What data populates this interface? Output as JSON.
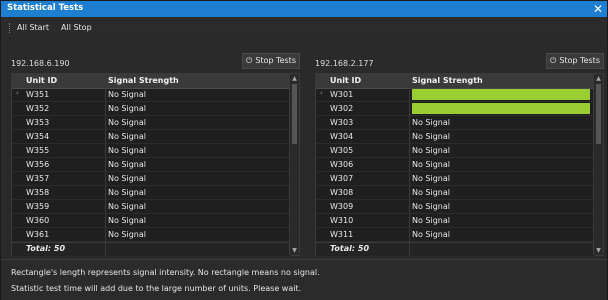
{
  "window": {
    "title": "Statistical Tests",
    "close_icon": "close-icon"
  },
  "menubar": {
    "items": [
      "All Start",
      "All Stop"
    ]
  },
  "colors": {
    "titlebar": "#1e7fd1",
    "signal_bar": "#9acd32",
    "background": "#2a2a2a"
  },
  "left": {
    "ip": "192.168.6.190",
    "stop_label": "Stop Tests",
    "columns": [
      "Unit ID",
      "Signal Strength"
    ],
    "rows": [
      {
        "id": "W351",
        "signal": "No Signal",
        "selected": true
      },
      {
        "id": "W352",
        "signal": "No Signal"
      },
      {
        "id": "W353",
        "signal": "No Signal"
      },
      {
        "id": "W354",
        "signal": "No Signal"
      },
      {
        "id": "W355",
        "signal": "No Signal"
      },
      {
        "id": "W356",
        "signal": "No Signal"
      },
      {
        "id": "W357",
        "signal": "No Signal"
      },
      {
        "id": "W358",
        "signal": "No Signal"
      },
      {
        "id": "W359",
        "signal": "No Signal"
      },
      {
        "id": "W360",
        "signal": "No Signal"
      },
      {
        "id": "W361",
        "signal": "No Signal"
      }
    ],
    "total": "Total: 50"
  },
  "right": {
    "ip": "192.168.2.177",
    "stop_label": "Stop Tests",
    "columns": [
      "Unit ID",
      "Signal Strength"
    ],
    "rows": [
      {
        "id": "W301",
        "signal": "",
        "selected": true,
        "signal_level": 1.0
      },
      {
        "id": "W302",
        "signal": "",
        "signal_level": 1.0
      },
      {
        "id": "W303",
        "signal": "No Signal"
      },
      {
        "id": "W304",
        "signal": "No Signal"
      },
      {
        "id": "W305",
        "signal": "No Signal"
      },
      {
        "id": "W306",
        "signal": "No Signal"
      },
      {
        "id": "W307",
        "signal": "No Signal"
      },
      {
        "id": "W308",
        "signal": "No Signal"
      },
      {
        "id": "W309",
        "signal": "No Signal"
      },
      {
        "id": "W310",
        "signal": "No Signal"
      },
      {
        "id": "W311",
        "signal": "No Signal"
      }
    ],
    "total": "Total: 50"
  },
  "footer": {
    "note1": "Rectangle's length represents signal intensity. No rectangle means no signal.",
    "note2": "Statistic test time will add due to the large number of units. Please wait."
  }
}
